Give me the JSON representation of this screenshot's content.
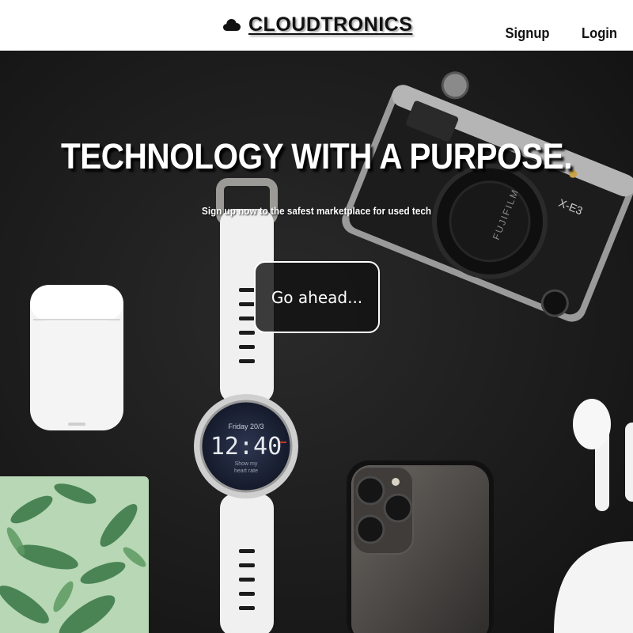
{
  "header": {
    "brand": "CLOUDTRONICS",
    "nav": [
      {
        "label": "Signup"
      },
      {
        "label": "Login"
      }
    ]
  },
  "hero": {
    "headline": "TECHNOLOGY WITH A PURPOSE.",
    "subline": "Sign up now to the safest marketplace for used tech",
    "cta_label": "Go ahead...",
    "photo": {
      "watch_date": "Friday 20/3",
      "watch_time": "12:40",
      "watch_hint_1": "Show my",
      "watch_hint_2": "heart rate",
      "camera_model": "X-E3",
      "camera_brand": "FUJIFILM"
    }
  },
  "colors": {
    "header_bg": "#ffffff",
    "hero_bg": "#1a1a1a",
    "text_light": "#ffffff",
    "text_dark": "#111111"
  }
}
